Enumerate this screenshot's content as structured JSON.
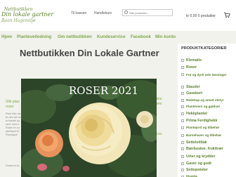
{
  "header": {
    "logo_line1": "Nettbutikken",
    "logo_line2": "Din lokale gartner",
    "logo_line3": "Baan Hagemiljø",
    "top_links": [
      "Til kassen",
      "Handlekurv"
    ],
    "search_placeholder": "Søk produkter...",
    "cart_text": "kr 0,00  0 produkter"
  },
  "nav": {
    "items": [
      "Hjem",
      "Planteveiledning",
      "Om nettbutikken",
      "Kundeservice",
      "Facebook",
      "Min konto"
    ]
  },
  "main": {
    "title": "Nettbutikken Din Lokale Gartner",
    "hero_caption": "ROSER 2021",
    "left_strip": [
      "Slik plan",
      "roser"
    ],
    "left_strip_small": [
      "Plant ikke ros",
      "ta vare på ros",
      "ta bundet op",
      "sted, med d",
      "Rosen er no",
      "plantepot M",
      "Plantligodi",
      "Posted in Ar"
    ],
    "right_strip": [
      "riske",
      "nøre",
      "i Les",
      "e"
    ]
  },
  "sidebar": {
    "title": "PRODUKTKATEGORIER",
    "items": [
      "Klematis",
      "Roser",
      "Frø og dyrk selv løsninger",
      "Stauder",
      "Gavekort",
      "Redskap og annet utstyr",
      "Plantevern og gjødsel",
      "Hekkplanter",
      "Prima Ferdighekk",
      "Plantejord og tilbehør",
      "Barnehaver og tilbehør",
      "Settelvittlak",
      "Bærbusker, frukttrær",
      "Urter og krydder",
      "Gaver og godt",
      "Settepoteter",
      "Humle"
    ]
  },
  "colors": {
    "brand_green": "#7ea84a",
    "sidebar_link": "#5a7f2a",
    "title_grey": "#444444"
  }
}
